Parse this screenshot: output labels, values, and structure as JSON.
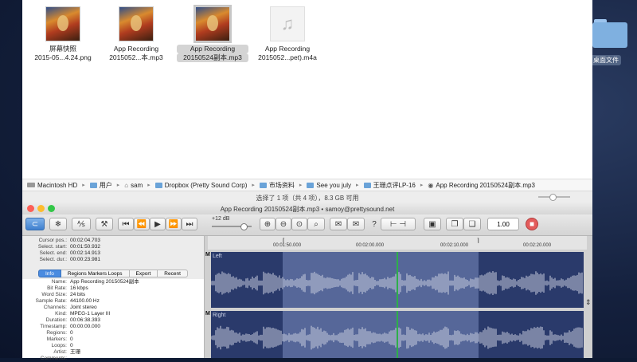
{
  "desktop": {
    "folder_label": "桌面文件"
  },
  "finder": {
    "files": [
      {
        "line1": "屏幕快照",
        "line2": "2015-05...4.24.png",
        "kind": "image"
      },
      {
        "line1": "App Recording",
        "line2": "2015052...本.mp3",
        "kind": "image"
      },
      {
        "line1": "App Recording",
        "line2": "20150524副本.mp3",
        "kind": "image"
      },
      {
        "line1": "App Recording",
        "line2": "2015052...pet).m4a",
        "kind": "audio"
      }
    ],
    "path": [
      {
        "label": "Macintosh HD"
      },
      {
        "label": "用户"
      },
      {
        "label": "sam"
      },
      {
        "label": "Dropbox (Pretty Sound Corp)"
      },
      {
        "label": "市场资料"
      },
      {
        "label": "See you july"
      },
      {
        "label": "王珊点评LP-16"
      },
      {
        "label": "App Recording 20150524副本.mp3"
      }
    ],
    "status": "选择了 1 项（共 4 项），8.3 GB 可用"
  },
  "audio_window": {
    "title": "App Recording 20150524副本.mp3 • samoy@prettysound.net",
    "gain_label": "+12 dB",
    "speed_value": "1.00",
    "selection": [
      {
        "key": "Cursor pos.:",
        "value": "00:02:04.703"
      },
      {
        "key": "Select. start:",
        "value": "00:01:50.932"
      },
      {
        "key": "Select. end:",
        "value": "00:02:14.913"
      },
      {
        "key": "Select. dur.:",
        "value": "00:00:23.981"
      }
    ],
    "tabs": [
      "Info",
      "Regions Markers Loops",
      "Export",
      "Recent"
    ],
    "info": [
      {
        "key": "Name:",
        "value": "App Recording 20150524副本"
      },
      {
        "key": "Bit Rate:",
        "value": "16 kbps"
      },
      {
        "key": "Word Size:",
        "value": "24 bits"
      },
      {
        "key": "Sample Rate:",
        "value": "44100.00 Hz"
      },
      {
        "key": "Channels:",
        "value": "Joint stereo"
      },
      {
        "key": "Kind:",
        "value": "MPEG-1 Layer III"
      },
      {
        "key": "Duration:",
        "value": "00:06:38.393"
      },
      {
        "key": "Timestamp:",
        "value": "00:00:00.000"
      },
      {
        "key": "Regions:",
        "value": "0"
      },
      {
        "key": "Markers:",
        "value": "0"
      },
      {
        "key": "Loops:",
        "value": "0"
      },
      {
        "key": "Artist:",
        "value": "王珊"
      },
      {
        "key": "Comments:",
        "value": ""
      }
    ],
    "ruler": [
      "00:01:50.000",
      "00:02:00.000",
      "00:02:10.000",
      "00:02:20.000"
    ],
    "tracks": [
      {
        "channel": "M",
        "name": "Left"
      },
      {
        "channel": "M",
        "name": "Right"
      }
    ]
  }
}
